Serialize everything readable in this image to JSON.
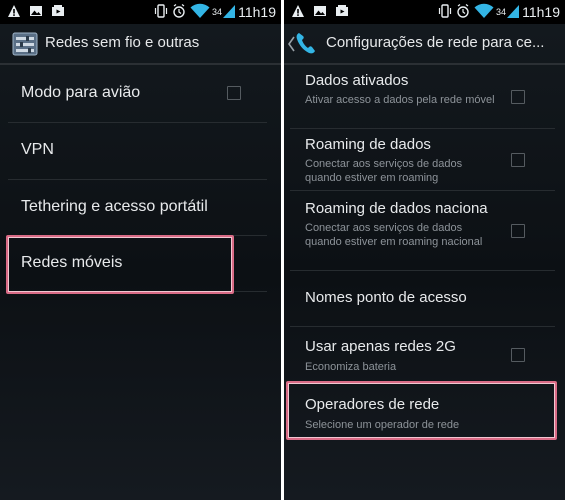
{
  "status_bar": {
    "left_icons": [
      "warning-icon",
      "image-icon",
      "media-icon"
    ],
    "right_icons": [
      "vibrate-icon",
      "alarm-icon",
      "wifi-icon"
    ],
    "network_type": "34",
    "time": "11h19"
  },
  "left_screen": {
    "title": "Redes sem fio e outras",
    "items": [
      {
        "label": "Modo para avião",
        "checkbox": true,
        "checked": false
      },
      {
        "label": "VPN"
      },
      {
        "label": "Tethering e acesso portátil"
      },
      {
        "label": "Redes móveis",
        "highlighted": true
      }
    ]
  },
  "right_screen": {
    "title": "Configurações de rede para ce...",
    "items": [
      {
        "title": "Dados ativados",
        "summary": "Ativar acesso a dados pela rede móvel",
        "checked": false
      },
      {
        "title": "Roaming de dados",
        "summary": "Conectar aos serviços de dados quando estiver em roaming",
        "checked": false
      },
      {
        "title": "Roaming de dados naciona",
        "summary": "Conectar aos serviços de dados quando estiver em roaming nacional",
        "checked": false
      },
      {
        "title": "Nomes ponto de acesso"
      },
      {
        "title": "Usar apenas redes 2G",
        "summary": "Economiza bateria",
        "checked": false
      },
      {
        "title": "Operadores de rede",
        "summary": "Selecione um operador de rede",
        "highlighted": true
      }
    ]
  },
  "colors": {
    "highlight_border": "#d96b86",
    "phone_accent": "#33b5e5",
    "background": "#0f1418"
  }
}
